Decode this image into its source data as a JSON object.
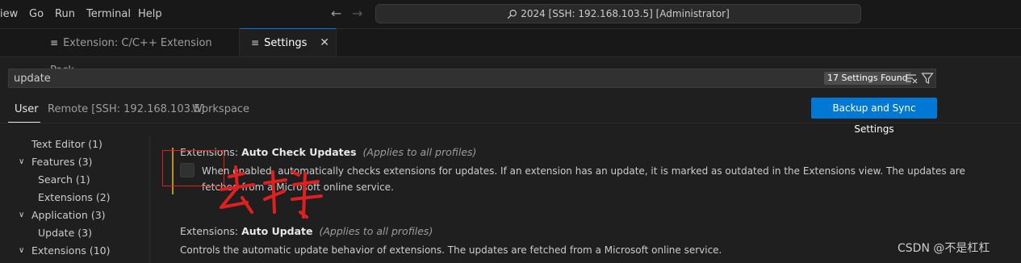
{
  "menu": [
    "iew",
    "Go",
    "Run",
    "Terminal",
    "Help"
  ],
  "command_center": "2024 [SSH: 192.168.103.5] [Administrator]",
  "tabs": [
    {
      "label": "Extension: C/C++ Extension Pack",
      "icon": "preview-icon"
    },
    {
      "label": "Settings",
      "icon": "settings-file-icon"
    }
  ],
  "search": {
    "value": "update",
    "count": "17 Settings Found"
  },
  "scopes": [
    "User",
    "Remote [SSH: 192.168.103.5]",
    "Workspace"
  ],
  "sync_button": "Backup and Sync Settings",
  "toc": [
    {
      "label": "Text Editor (1)"
    },
    {
      "label": "Features (3)"
    },
    {
      "label": "Search (1)"
    },
    {
      "label": "Extensions (2)"
    },
    {
      "label": "Application (3)"
    },
    {
      "label": "Update (3)"
    },
    {
      "label": "Extensions (10)"
    }
  ],
  "settings": [
    {
      "category": "Extensions:",
      "name": "Auto Check Updates",
      "scope_note": "(Applies to all profiles)",
      "description_1": "When enabled, automatically checks extensions for updates. If an extension has an update, it is marked as outdated in the Extensions view. The updates are",
      "description_2": "fetched from a Microsoft online service.",
      "checked": false
    },
    {
      "category": "Extensions:",
      "name": "Auto Update",
      "scope_note": "(Applies to all profiles)",
      "description_1": "Controls the automatic update behavior of extensions. The updates are fetched from a Microsoft online service."
    }
  ],
  "annotation": {
    "text": "去掉",
    "color": "#e02020"
  },
  "watermark": "CSDN @不是杠杠",
  "colors": {
    "accent": "#0078d4",
    "modified": "#b89500",
    "background": "#1f1f1f"
  }
}
